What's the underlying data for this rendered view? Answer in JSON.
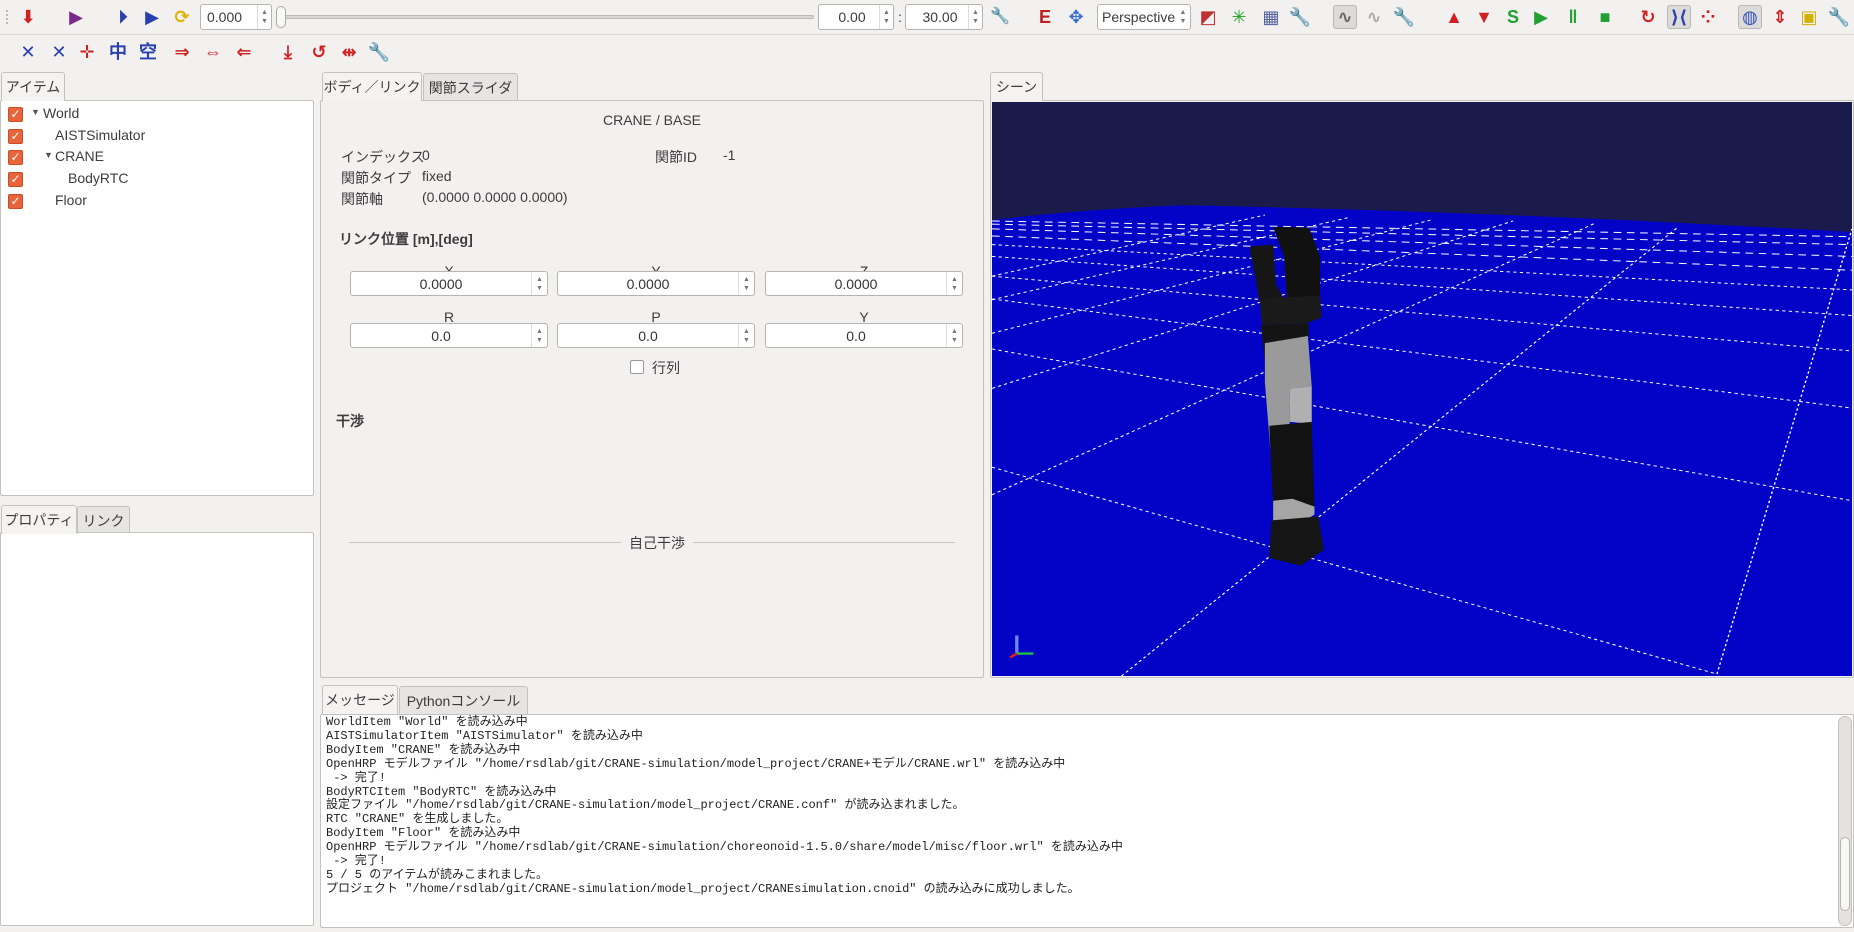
{
  "toolbar": {
    "row1": [
      {
        "icon": "load-project-icon",
        "color": "#d02020",
        "glyph": "⬇"
      },
      {
        "icon": "script-icon",
        "color": "#7a2a8a",
        "glyph": "▶"
      },
      {
        "icon": "play-from-start-icon",
        "color": "#2a3fb0",
        "glyph": "⏵"
      },
      {
        "icon": "play-icon",
        "color": "#2a3fb0",
        "glyph": "▶"
      },
      {
        "icon": "refresh-icon",
        "color": "#e0b400",
        "glyph": "⟳"
      }
    ],
    "time_value": "0.000",
    "time_slider_position": 0,
    "range_start": "0.00",
    "range_separator": ":",
    "range_end": "30.00",
    "camera_mode": "Perspective",
    "row1_right": [
      {
        "icon": "edit-mode-icon",
        "color": "#c02020",
        "glyph": "E"
      },
      {
        "icon": "view-arrows-icon",
        "color": "#3a6fd0",
        "glyph": "✥"
      },
      {
        "icon": "fit-view-icon",
        "color": "#c03030",
        "glyph": "◩"
      },
      {
        "icon": "light-icon",
        "color": "#20a020",
        "glyph": "✳"
      },
      {
        "icon": "grid-icon",
        "color": "#5060a0",
        "glyph": "▦"
      },
      {
        "icon": "wrench-icon",
        "color": "#555a70",
        "glyph": "🔧"
      },
      {
        "icon": "wave-icon",
        "color": "#666",
        "glyph": "∿",
        "pressed": true
      },
      {
        "icon": "wave-disabled-icon",
        "color": "#aaa",
        "glyph": "∿"
      },
      {
        "icon": "wrench-disabled-icon",
        "color": "#aaa",
        "glyph": "🔧"
      },
      {
        "icon": "globe-up-icon",
        "color": "#d02020",
        "glyph": "▲"
      },
      {
        "icon": "globe-down-icon",
        "color": "#d02020",
        "glyph": "▼"
      },
      {
        "icon": "sim-start-icon",
        "color": "#20a030",
        "glyph": "S"
      },
      {
        "icon": "sim-resume-icon",
        "color": "#20a030",
        "glyph": "▶"
      },
      {
        "icon": "sim-pause-icon",
        "color": "#20a030",
        "glyph": "‖"
      },
      {
        "icon": "sim-stop-icon",
        "color": "#20a030",
        "glyph": "■"
      },
      {
        "icon": "joint-rotate-icon",
        "color": "#d02020",
        "glyph": "↻"
      },
      {
        "icon": "link-bracket-icon",
        "color": "#2a3fb0",
        "glyph": "⟩⟨",
        "pressed": true
      },
      {
        "icon": "link-chain-icon",
        "color": "#d02020",
        "glyph": "⁘"
      },
      {
        "icon": "collision-globe-icon",
        "color": "#3050c0",
        "glyph": "◍",
        "pressed": true
      },
      {
        "icon": "compress-icon",
        "color": "#d02020",
        "glyph": "⇕"
      },
      {
        "icon": "window-icon",
        "color": "#d0b000",
        "glyph": "▣"
      },
      {
        "icon": "wrench-icon",
        "color": "#555a70",
        "glyph": "🔧"
      }
    ],
    "row2": [
      {
        "icon": "body-move-icon",
        "color": "#2a3fb0",
        "glyph": "✕"
      },
      {
        "icon": "body-move-alt-icon",
        "color": "#2a3fb0",
        "glyph": "✕"
      },
      {
        "icon": "joint-point-icon",
        "color": "#d02020",
        "glyph": "✛"
      },
      {
        "icon": "body-stance-icon",
        "color": "#2a3fb0",
        "glyph": "中"
      },
      {
        "icon": "body-stance-alt-icon",
        "color": "#2a3fb0",
        "glyph": "空"
      },
      {
        "icon": "copy-pose-icon",
        "color": "#d02020",
        "glyph": "⇒"
      },
      {
        "icon": "paste-pose-icon",
        "color": "#d02020",
        "glyph": "⇔"
      },
      {
        "icon": "flip-pose-icon",
        "color": "#d02020",
        "glyph": "⇐"
      },
      {
        "icon": "origin-pose-icon",
        "color": "#d02020",
        "glyph": "⤓"
      },
      {
        "icon": "reset-icon",
        "color": "#d02020",
        "glyph": "↺"
      },
      {
        "icon": "symmetric-icon",
        "color": "#d02020",
        "glyph": "⇹"
      },
      {
        "icon": "wrench-icon",
        "color": "#555a70",
        "glyph": "🔧"
      }
    ]
  },
  "items_panel": {
    "tab": "アイテム",
    "items": [
      {
        "label": "World",
        "checked": true,
        "expanded": true
      },
      {
        "label": "AISTSimulator",
        "checked": true
      },
      {
        "label": "CRANE",
        "checked": true,
        "expanded": true
      },
      {
        "label": "BodyRTC",
        "checked": true
      },
      {
        "label": "Floor",
        "checked": true
      }
    ]
  },
  "property_panel": {
    "tabs": [
      "プロパティ",
      "リンク"
    ]
  },
  "body_link": {
    "tabs": [
      "ボディ／リンク",
      "関節スライダ"
    ],
    "title": "CRANE / BASE",
    "index_label": "インデックス",
    "index_value": "0",
    "joint_id_label": "関節ID",
    "joint_id_value": "-1",
    "joint_type_label": "関節タイプ",
    "joint_type_value": "fixed",
    "joint_axis_label": "関節軸",
    "joint_axis_value": "(0.0000 0.0000 0.0000)",
    "position_heading": "リンク位置 [m],[deg]",
    "position": [
      {
        "label": "X",
        "value": "0.0000"
      },
      {
        "label": "Y",
        "value": "0.0000"
      },
      {
        "label": "Z",
        "value": "0.0000"
      }
    ],
    "rotation": [
      {
        "label": "R",
        "value": "0.0"
      },
      {
        "label": "P",
        "value": "0.0"
      },
      {
        "label": "Y",
        "value": "0.0"
      }
    ],
    "matrix_label": "行列",
    "matrix_checked": false,
    "collision_heading": "干渉",
    "self_collision_label": "自己干渉"
  },
  "scene": {
    "tab": "シーン",
    "colors": {
      "sky": "#1b1b4b",
      "floor": "#0303c8",
      "grid": "#ffffff"
    }
  },
  "messages": {
    "tabs": [
      "メッセージ",
      "Pythonコンソール"
    ],
    "lines": [
      "WorldItem \"World\" を読み込み中",
      "AISTSimulatorItem \"AISTSimulator\" を読み込み中",
      "BodyItem \"CRANE\" を読み込み中",
      "OpenHRP モデルファイル \"/home/rsdlab/git/CRANE-simulation/model_project/CRANE+モデル/CRANE.wrl\" を読み込み中",
      " -> 完了!",
      "BodyRTCItem \"BodyRTC\" を読み込み中",
      "設定ファイル \"/home/rsdlab/git/CRANE-simulation/model_project/CRANE.conf\" が読み込まれました。",
      "RTC \"CRANE\" を生成しました。",
      "BodyItem \"Floor\" を読み込み中",
      "OpenHRP モデルファイル \"/home/rsdlab/git/CRANE-simulation/choreonoid-1.5.0/share/model/misc/floor.wrl\" を読み込み中",
      " -> 完了!",
      "5 / 5 のアイテムが読みこまれました。",
      "プロジェクト \"/home/rsdlab/git/CRANE-simulation/model_project/CRANEsimulation.cnoid\" の読み込みに成功しました。"
    ]
  }
}
